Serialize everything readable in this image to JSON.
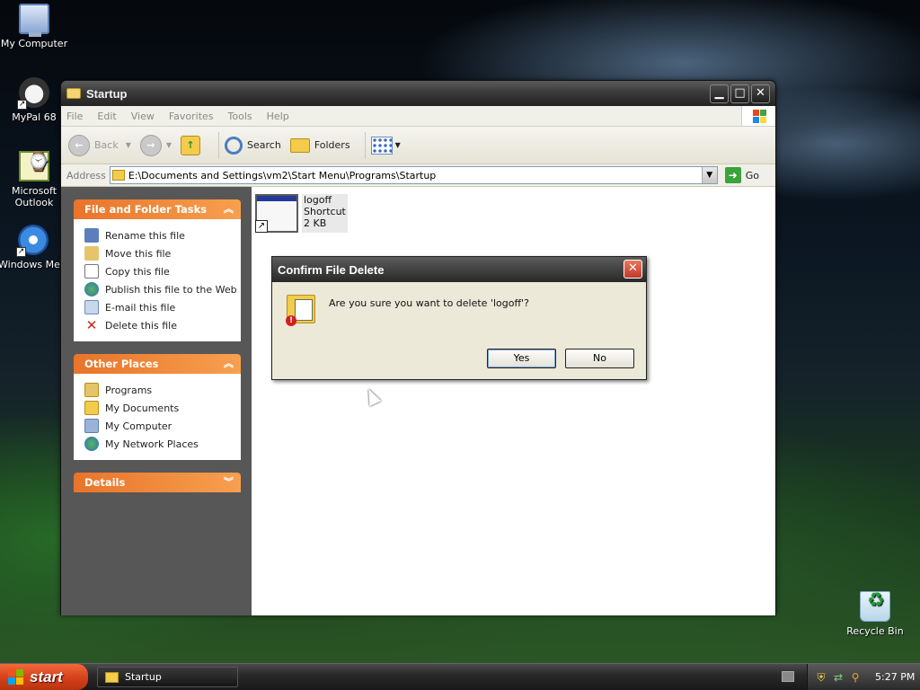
{
  "desktop": {
    "icons": [
      {
        "label": "My Computer",
        "icon": "my-computer-icon"
      },
      {
        "label": "MyPal 68",
        "icon": "mypal-icon"
      },
      {
        "label": "Microsoft Outlook",
        "icon": "outlook-icon"
      },
      {
        "label": "Windows Media Player",
        "icon": "media-player-icon"
      },
      {
        "label": "Recycle Bin",
        "icon": "recycle-bin-icon"
      }
    ]
  },
  "window": {
    "title": "Startup",
    "menu": [
      "File",
      "Edit",
      "View",
      "Favorites",
      "Tools",
      "Help"
    ],
    "toolbar": {
      "back": "Back",
      "search": "Search",
      "folders": "Folders"
    },
    "address": {
      "label": "Address",
      "value": "E:\\Documents and Settings\\vm2\\Start Menu\\Programs\\Startup",
      "go": "Go"
    },
    "tasks": {
      "file_folder": {
        "title": "File and Folder Tasks",
        "items": [
          "Rename this file",
          "Move this file",
          "Copy this file",
          "Publish this file to the Web",
          "E-mail this file",
          "Delete this file"
        ]
      },
      "other_places": {
        "title": "Other Places",
        "items": [
          "Programs",
          "My Documents",
          "My Computer",
          "My Network Places"
        ]
      },
      "details": {
        "title": "Details"
      }
    },
    "file": {
      "name": "logoff",
      "type": "Shortcut",
      "size": "2 KB"
    }
  },
  "dialog": {
    "title": "Confirm File Delete",
    "message": "Are you sure you want to delete 'logoff'?",
    "yes": "Yes",
    "no": "No",
    "close": "✕"
  },
  "taskbar": {
    "start": "start",
    "task": "Startup",
    "clock": "5:27 PM"
  },
  "colors": {
    "accent_orange": "#e8742a",
    "title_dark": "#3a3a3a",
    "dialog_bg": "#ece9d8"
  }
}
